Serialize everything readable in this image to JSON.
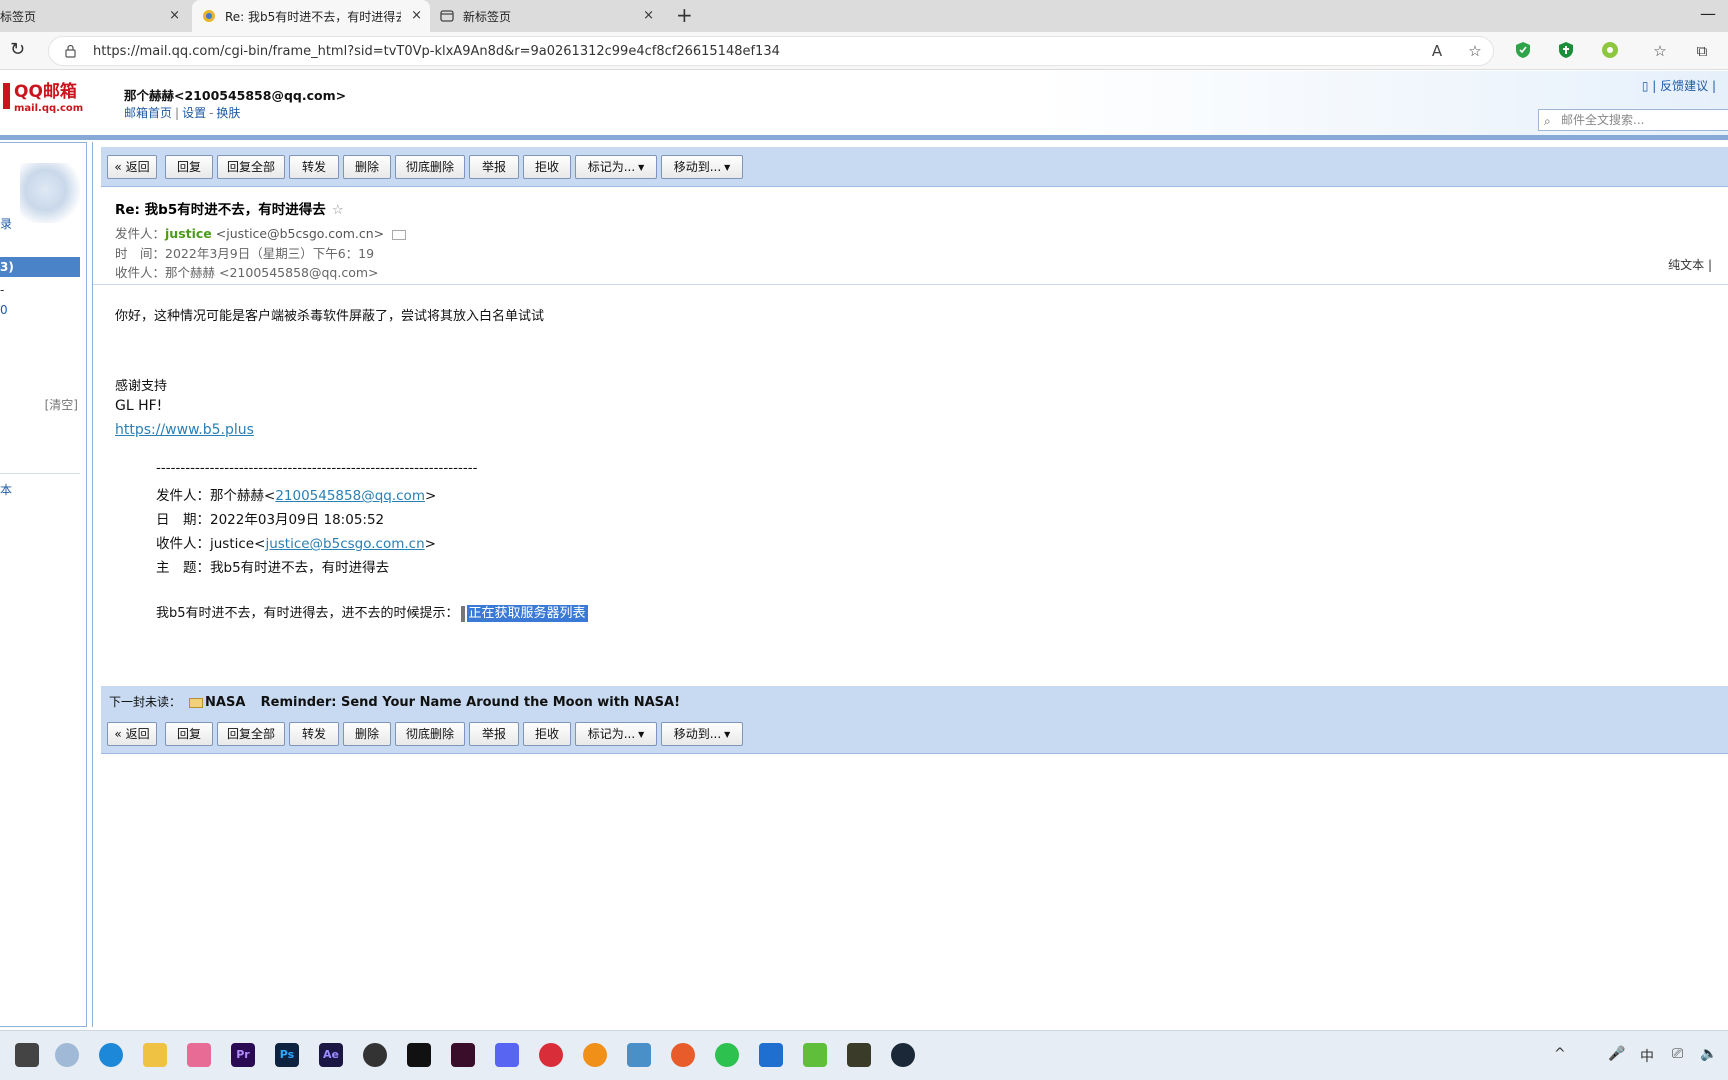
{
  "browser": {
    "tabs": [
      {
        "title": "标签页",
        "active": false
      },
      {
        "title": "Re: 我b5有时进不去，有时进得去",
        "active": true
      },
      {
        "title": "新标签页",
        "active": false
      }
    ],
    "close_glyph": "×",
    "new_tab_glyph": "+",
    "minimize_glyph": "—",
    "url": "https://mail.qq.com/cgi-bin/frame_html?sid=tvT0Vp-klxA9An8d&r=9a0261312c99e4cf8cf26615148ef134",
    "icons": [
      "read-aloud-icon",
      "favorite-icon",
      "shield-extension-icon",
      "shield-green-icon",
      "extension-icon",
      "favorites-icon",
      "collections-icon"
    ]
  },
  "mail_header": {
    "logo_text": "QQ邮箱",
    "logo_sub": "mail.qq.com",
    "user": "那个赫赫<2100545858@qq.com>",
    "links": [
      "邮箱首页",
      "设置",
      "换肤"
    ],
    "feedback": "反馈建议",
    "search_placeholder": "邮件全文搜索..."
  },
  "sidebar": {
    "item_top": "录",
    "selected": "3)",
    "item_a": "-",
    "item_b": "0",
    "clear": "[清空]",
    "item_c": "本"
  },
  "toolbar": {
    "back": "« 返回",
    "reply": "回复",
    "reply_all": "回复全部",
    "forward": "转发",
    "delete": "删除",
    "perm_delete": "彻底删除",
    "report": "举报",
    "reject": "拒收",
    "mark_as": "标记为...",
    "move_to": "移动到..."
  },
  "email": {
    "subject": "Re: 我b5有时进不去，有时进得去",
    "star": "☆",
    "from_label": "发件人：",
    "from_name": "justice",
    "from_addr": "<justice@b5csgo.com.cn>",
    "time_label": "时　间：",
    "time": "2022年3月9日（星期三）下午6：19",
    "to_label": "收件人：",
    "to": "那个赫赫 <2100545858@qq.com>",
    "plain_text": "纯文本",
    "body_line": "你好，这种情况可能是客户端被杀毒软件屏蔽了，尝试将其放入白名单试试",
    "thanks": "感谢支持",
    "glhf": "GL HF!",
    "site": "https://www.b5.plus",
    "divider": "------------------------------------------------------------------",
    "q_from_label": "发件人：那个赫赫<",
    "q_from_link": "2100545858@qq.com",
    "q_from_end": ">",
    "q_date": "日　期：2022年03月09日 18:05:52",
    "q_to_label": "收件人：justice<",
    "q_to_link": "justice@b5csgo.com.cn",
    "q_to_end": ">",
    "q_subject": "主　题：我b5有时进不去，有时进得去",
    "q_body": "我b5有时进不去，有时进得去，进不去的时候提示：",
    "q_highlight": "正在获取服务器列表"
  },
  "next_unread": {
    "label": "下一封未读：",
    "sender": "NASA",
    "subject": "Reminder: Send Your Name Around the Moon with NASA!"
  },
  "taskbar": {
    "icons": [
      "start-icon",
      "onedrive-icon",
      "edge-icon",
      "file-explorer-icon",
      "bilibili-icon",
      "premiere-icon",
      "photoshop-icon",
      "after-effects-icon",
      "obs-icon",
      "capcut-icon",
      "an-icon",
      "discord-icon",
      "netease-music-icon",
      "search-app-icon",
      "steam-tool-icon",
      "orange-app-icon",
      "wechat-icon",
      "bluetooth-app-icon",
      "green-app-icon",
      "game-icon",
      "steam-icon"
    ],
    "tray_lang": "中"
  }
}
